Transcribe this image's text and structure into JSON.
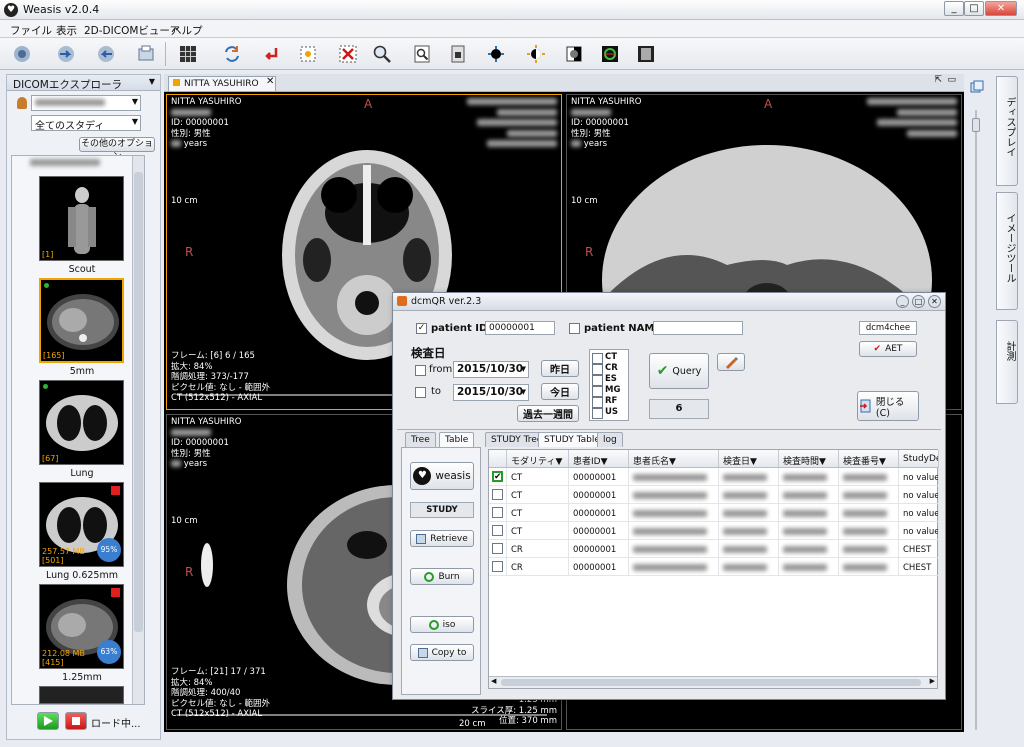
{
  "window": {
    "title": "Weasis v2.0.4"
  },
  "menu": [
    "ファイル",
    "表示",
    "2D-DICOMビューア",
    "ヘルプ"
  ],
  "explorer": {
    "title": "DICOMエクスプローラ",
    "study_select": "全てのスタディ",
    "more_options": "その他のオプション",
    "loading_label": "ロード中..."
  },
  "series": [
    {
      "label": "Scout",
      "count": "[1]"
    },
    {
      "label": "5mm",
      "count": "[165]"
    },
    {
      "label": "Lung",
      "count": "[67]"
    },
    {
      "label": "Lung 0.625mm",
      "count": "[501]",
      "size": "257.57 MB",
      "progress": "95%"
    },
    {
      "label": "1.25mm",
      "count": "[415]",
      "size": "212.08 MB",
      "progress": "63%"
    }
  ],
  "viewer": {
    "tab_label": "NITTA YASUHIRO",
    "views": [
      {
        "name": "NITTA YASUHIRO",
        "id": "ID: 00000001",
        "sex": "性別: 男性",
        "age": "years",
        "scale": "10 cm",
        "orient_top": "A",
        "orient_left": "R",
        "frame": "フレーム: [6] 6 / 165",
        "zoom": "拡大: 84%",
        "wl": "階調処理: 373/-177",
        "pixel": "ピクセル値: なし - 範囲外",
        "series": "CT (512x512) - AXIAL"
      },
      {
        "name": "NITTA YASUHIRO",
        "id": "ID: 00000001",
        "sex": "性別: 男性",
        "age": "years",
        "scale": "10 cm",
        "orient_top": "A",
        "orient_left": "R"
      },
      {
        "name": "NITTA YASUHIRO",
        "id": "ID: 00000001",
        "sex": "性別: 男性",
        "age": "years",
        "scale": "10 cm",
        "orient_left": "R",
        "frame": "フレーム: [21] 17 / 371",
        "zoom": "拡大: 84%",
        "wl": "階調処理: 400/40",
        "pixel": "ピクセル値: なし - 範囲外",
        "series": "CT (512x512) - AXIAL",
        "scale_bottom": "20 cm",
        "thickness": "1.25 mm",
        "slice": "スライス厚: 1.25 mm",
        "position": "位置: 370 mm"
      }
    ]
  },
  "right_tabs": [
    "ディスプレイ",
    "イメージツール",
    "計測"
  ],
  "dialog": {
    "title": "dcmQR ver.2.3",
    "patient_id_label": "patient ID",
    "patient_id_value": "00000001",
    "patient_id_checked": true,
    "patient_name_label": "patient NAME",
    "patient_name_value": "",
    "aet_value": "dcm4chee",
    "aet_button": "AET",
    "exam_date_label": "検査日",
    "from_label": "from",
    "from_date": "2015/10/30",
    "to_label": "to",
    "to_date": "2015/10/30",
    "yesterday": "昨日",
    "today": "今日",
    "past_week": "過去一週間",
    "modalities": [
      "CT",
      "CR",
      "ES",
      "MG",
      "RF",
      "US"
    ],
    "query_button": "Query",
    "result_count": "6",
    "close_button": "閉じる(C)",
    "left_tabs": [
      "Tree",
      "Table"
    ],
    "weasis_button": "weasis",
    "study_label": "STUDY",
    "retrieve_button": "Retrieve",
    "burn_button": "Burn",
    "iso_button": "iso",
    "copy_button": "Copy to",
    "result_tabs": [
      "STUDY Tree",
      "STUDY Table",
      "log"
    ],
    "columns": [
      "モダリティ▼",
      "患者ID▼",
      "患者氏名▼",
      "検査日▼",
      "検査時間▼",
      "検査番号▼",
      "StudyDes"
    ],
    "rows": [
      {
        "checked": true,
        "modality": "CT",
        "pid": "00000001",
        "desc": "no value"
      },
      {
        "checked": false,
        "modality": "CT",
        "pid": "00000001",
        "desc": "no value"
      },
      {
        "checked": false,
        "modality": "CT",
        "pid": "00000001",
        "desc": "no value"
      },
      {
        "checked": false,
        "modality": "CT",
        "pid": "00000001",
        "desc": "no value"
      },
      {
        "checked": false,
        "modality": "CR",
        "pid": "00000001",
        "desc": "CHEST"
      },
      {
        "checked": false,
        "modality": "CR",
        "pid": "00000001",
        "desc": "CHEST"
      }
    ]
  },
  "colors": {
    "accent_orange": "#f0a400",
    "orient_red": "#c0504d",
    "play_green": "#2fb52f",
    "stop_red": "#e02020"
  }
}
